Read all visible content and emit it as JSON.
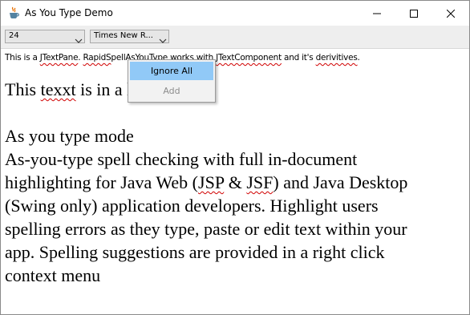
{
  "window": {
    "title": "As You Type Demo",
    "icons": {
      "app": "java-cup-icon",
      "minimize": "minimize-icon",
      "maximize": "maximize-icon",
      "close": "close-icon"
    }
  },
  "toolbar": {
    "font_size": "24",
    "font_name": "Times New R..."
  },
  "content": {
    "description_line": [
      {
        "text": "This is a ",
        "err": false
      },
      {
        "text": "JTextPane",
        "err": true
      },
      {
        "text": ". ",
        "err": false
      },
      {
        "text": "RapidS",
        "err": true
      },
      {
        "text": "pellAsYouType works with ",
        "err": false
      },
      {
        "text": "JTextComponent",
        "err": true
      },
      {
        "text": " and it's ",
        "err": false
      },
      {
        "text": "derivitives",
        "err": true
      },
      {
        "text": ".",
        "err": false
      }
    ],
    "lines": [
      [
        {
          "text": "This ",
          "err": false
        },
        {
          "text": "texxt",
          "err": true
        },
        {
          "text": " is in a large font.",
          "err": false
        }
      ],
      [
        {
          "text": " ",
          "err": false
        }
      ],
      [
        {
          "text": "As you type mode",
          "err": false
        }
      ],
      [
        {
          "text": "As-you-type spell checking with full in-document",
          "err": false
        }
      ],
      [
        {
          "text": "highlighting for Java Web (",
          "err": false
        },
        {
          "text": "JSP",
          "err": true
        },
        {
          "text": " & ",
          "err": false
        },
        {
          "text": "JSF",
          "err": true
        },
        {
          "text": ") and Java Desktop",
          "err": false
        }
      ],
      [
        {
          "text": "(Swing only) application developers. Highlight users",
          "err": false
        }
      ],
      [
        {
          "text": "spelling errors as they type, paste or edit text within your",
          "err": false
        }
      ],
      [
        {
          "text": "app. Spelling suggestions are provided in a right click",
          "err": false
        }
      ],
      [
        {
          "text": "context menu",
          "err": false
        }
      ]
    ]
  },
  "context_menu": {
    "ignore_all": "Ignore All",
    "add": "Add"
  },
  "colors": {
    "menu_highlight": "#91c9f7",
    "spell_error": "#d00000",
    "disabled_text": "#8c8c8c"
  }
}
